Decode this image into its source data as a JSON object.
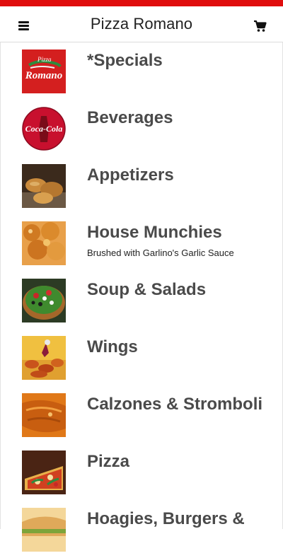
{
  "header": {
    "title": "Pizza Romano",
    "menu_icon": "hamburger-menu-icon",
    "cart_icon": "shopping-cart-icon"
  },
  "colors": {
    "brand_red": "#e00d0d",
    "title_text": "#4a4a4a"
  },
  "categories": [
    {
      "title": "*Specials",
      "subtitle": "",
      "logo_text": "Romano",
      "logo_small": "Pizza"
    },
    {
      "title": "Beverages",
      "subtitle": "",
      "logo_text": "Coca-Cola"
    },
    {
      "title": "Appetizers",
      "subtitle": ""
    },
    {
      "title": "House Munchies",
      "subtitle": "Brushed with Garlino's Garlic Sauce"
    },
    {
      "title": "Soup & Salads",
      "subtitle": ""
    },
    {
      "title": "Wings",
      "subtitle": ""
    },
    {
      "title": "Calzones & Stromboli",
      "subtitle": ""
    },
    {
      "title": "Pizza",
      "subtitle": ""
    },
    {
      "title": "Hoagies, Burgers &",
      "subtitle": ""
    }
  ]
}
